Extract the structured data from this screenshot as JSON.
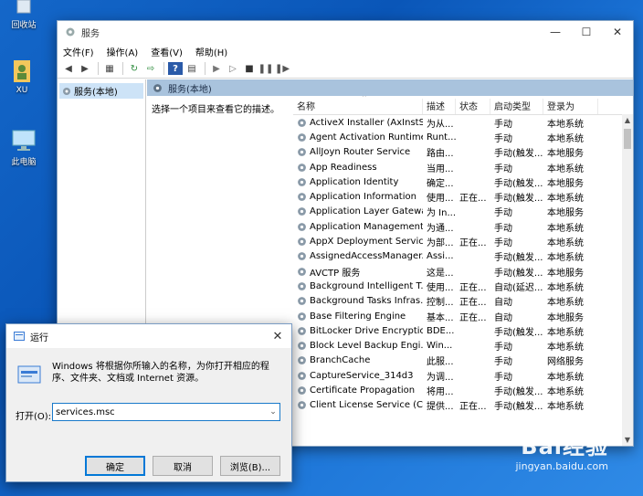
{
  "desktop": {
    "icons": [
      {
        "label": "回收站"
      },
      {
        "label": "XU"
      },
      {
        "label": "此电脑"
      }
    ]
  },
  "services_window": {
    "title": "服务",
    "menu": [
      "文件(F)",
      "操作(A)",
      "查看(V)",
      "帮助(H)"
    ],
    "tree_item": "服务(本地)",
    "pane_title": "服务(本地)",
    "description_hint": "选择一个项目来查看它的描述。",
    "columns": [
      "名称",
      "描述",
      "状态",
      "启动类型",
      "登录为"
    ],
    "rows": [
      [
        "ActiveX Installer (AxInstSV)",
        "为从...",
        "",
        "手动",
        "本地系统"
      ],
      [
        "Agent Activation Runtime...",
        "Runt...",
        "",
        "手动",
        "本地系统"
      ],
      [
        "AllJoyn Router Service",
        "路由...",
        "",
        "手动(触发...",
        "本地服务"
      ],
      [
        "App Readiness",
        "当用...",
        "",
        "手动",
        "本地系统"
      ],
      [
        "Application Identity",
        "确定...",
        "",
        "手动(触发...",
        "本地服务"
      ],
      [
        "Application Information",
        "使用...",
        "正在...",
        "手动(触发...",
        "本地系统"
      ],
      [
        "Application Layer Gatewa...",
        "为 In...",
        "",
        "手动",
        "本地服务"
      ],
      [
        "Application Management",
        "为通...",
        "",
        "手动",
        "本地系统"
      ],
      [
        "AppX Deployment Servic...",
        "为部...",
        "正在...",
        "手动",
        "本地系统"
      ],
      [
        "AssignedAccessManager...",
        "Assi...",
        "",
        "手动(触发...",
        "本地系统"
      ],
      [
        "AVCTP 服务",
        "这是...",
        "",
        "手动(触发...",
        "本地服务"
      ],
      [
        "Background Intelligent T...",
        "使用...",
        "正在...",
        "自动(延迟...",
        "本地系统"
      ],
      [
        "Background Tasks Infras...",
        "控制...",
        "正在...",
        "自动",
        "本地系统"
      ],
      [
        "Base Filtering Engine",
        "基本...",
        "正在...",
        "自动",
        "本地服务"
      ],
      [
        "BitLocker Drive Encryptio...",
        "BDE...",
        "",
        "手动(触发...",
        "本地系统"
      ],
      [
        "Block Level Backup Engi...",
        "Win...",
        "",
        "手动",
        "本地系统"
      ],
      [
        "BranchCache",
        "此服...",
        "",
        "手动",
        "网络服务"
      ],
      [
        "CaptureService_314d3",
        "为调...",
        "",
        "手动",
        "本地系统"
      ],
      [
        "Certificate Propagation",
        "将用...",
        "",
        "手动(触发...",
        "本地系统"
      ],
      [
        "Client License Service (Cli...",
        "提供...",
        "正在...",
        "手动(触发...",
        "本地系统"
      ]
    ]
  },
  "run_dialog": {
    "title": "运行",
    "description": "Windows 将根据你所输入的名称，为你打开相应的程序、文件夹、文档或 Internet 资源。",
    "open_label": "打开(O):",
    "input_value": "services.msc",
    "ok_label": "确定",
    "cancel_label": "取消",
    "browse_label": "浏览(B)..."
  },
  "watermark": {
    "logo": "Bai经验",
    "url": "jingyan.baidu.com"
  }
}
